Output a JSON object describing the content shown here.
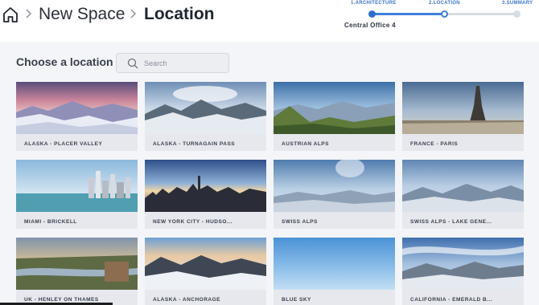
{
  "breadcrumb": {
    "home_icon": "home-icon",
    "separator_icon": "chevron-right-icon",
    "items": [
      "New Space",
      "Location"
    ]
  },
  "stepper": {
    "steps": [
      "1.ARCHITECTURE",
      "2.LOCATION",
      "3.SUMMARY"
    ],
    "current_step": 2,
    "subtitle": "Central Office 4",
    "colors": {
      "active": "#3f7fd9",
      "inactive": "#d7dbe2"
    }
  },
  "main": {
    "title": "Choose a location",
    "search": {
      "placeholder": "Search",
      "value": "",
      "icon": "search-icon"
    }
  },
  "locations": [
    {
      "label": "ALASKA - PLACER VALLEY"
    },
    {
      "label": "ALASKA - TURNAGAIN PASS"
    },
    {
      "label": "AUSTRIAN ALPS"
    },
    {
      "label": "FRANCE - PARIS"
    },
    {
      "label": "MIAMI - BRICKELL"
    },
    {
      "label": "NEW YORK CITY - HUDSO..."
    },
    {
      "label": "SWISS ALPS"
    },
    {
      "label": "SWISS ALPS - LAKE GENE..."
    },
    {
      "label": "UK - HENLEY ON THAMES"
    },
    {
      "label": "ALASKA - ANCHORAGE"
    },
    {
      "label": "BLUE SKY"
    },
    {
      "label": "CALIFORNIA - EMERALD B..."
    }
  ]
}
